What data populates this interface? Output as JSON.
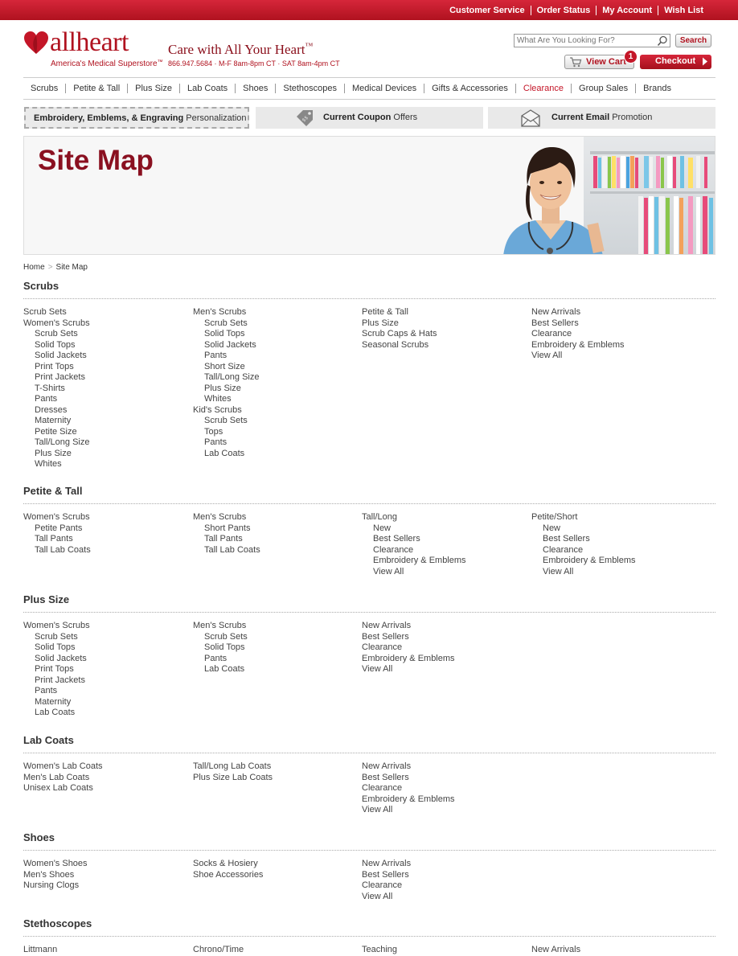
{
  "topbar": {
    "links": [
      "Customer Service",
      "Order Status",
      "My Account",
      "Wish List"
    ]
  },
  "brand": {
    "logo_text": "allheart",
    "tagline": "Care with All Your Heart",
    "superstore": "America's Medical Superstore",
    "hours": "866.947.5684 · M-F 8am-8pm CT · SAT 8am-4pm CT",
    "accent_color": "#b0121f"
  },
  "search": {
    "placeholder": "What Are You Looking For?",
    "button": "Search"
  },
  "cart": {
    "label": "View Cart",
    "count": "1",
    "checkout": "Checkout"
  },
  "nav": [
    "Scrubs",
    "Petite & Tall",
    "Plus Size",
    "Lab Coats",
    "Shoes",
    "Stethoscopes",
    "Medical Devices",
    "Gifts & Accessories",
    "Clearance",
    "Group Sales",
    "Brands"
  ],
  "promos": {
    "personalization_bold": "Embroidery, Emblems, & Engraving",
    "personalization_rest": "Personalization",
    "coupon_bold": "Current Coupon",
    "coupon_rest": "Offers",
    "email_bold": "Current Email",
    "email_rest": "Promotion"
  },
  "page_title": "Site Map",
  "breadcrumb": {
    "home": "Home",
    "current": "Site Map"
  },
  "sections": [
    {
      "title": "Scrubs",
      "columns": [
        [
          {
            "t": "Scrub Sets",
            "sub": false
          },
          {
            "t": "Women's Scrubs",
            "sub": false
          },
          {
            "t": "Scrub Sets",
            "sub": true
          },
          {
            "t": "Solid Tops",
            "sub": true
          },
          {
            "t": "Solid Jackets",
            "sub": true
          },
          {
            "t": "Print Tops",
            "sub": true
          },
          {
            "t": "Print Jackets",
            "sub": true
          },
          {
            "t": "T-Shirts",
            "sub": true
          },
          {
            "t": "Pants",
            "sub": true
          },
          {
            "t": "Dresses",
            "sub": true
          },
          {
            "t": "Maternity",
            "sub": true
          },
          {
            "t": "Petite Size",
            "sub": true
          },
          {
            "t": "Tall/Long Size",
            "sub": true
          },
          {
            "t": "Plus Size",
            "sub": true
          },
          {
            "t": "Whites",
            "sub": true
          }
        ],
        [
          {
            "t": "Men's Scrubs",
            "sub": false
          },
          {
            "t": "Scrub Sets",
            "sub": true
          },
          {
            "t": "Solid Tops",
            "sub": true
          },
          {
            "t": "Solid Jackets",
            "sub": true
          },
          {
            "t": "Pants",
            "sub": true
          },
          {
            "t": "Short Size",
            "sub": true
          },
          {
            "t": "Tall/Long Size",
            "sub": true
          },
          {
            "t": "Plus Size",
            "sub": true
          },
          {
            "t": "Whites",
            "sub": true
          },
          {
            "t": "Kid's Scrubs",
            "sub": false
          },
          {
            "t": "Scrub Sets",
            "sub": true
          },
          {
            "t": "Tops",
            "sub": true
          },
          {
            "t": "Pants",
            "sub": true
          },
          {
            "t": "Lab Coats",
            "sub": true
          }
        ],
        [
          {
            "t": "Petite & Tall",
            "sub": false
          },
          {
            "t": "Plus Size",
            "sub": false
          },
          {
            "t": "Scrub Caps & Hats",
            "sub": false
          },
          {
            "t": "Seasonal Scrubs",
            "sub": false
          }
        ],
        [
          {
            "t": "New Arrivals",
            "sub": false
          },
          {
            "t": "Best Sellers",
            "sub": false
          },
          {
            "t": "Clearance",
            "sub": false
          },
          {
            "t": "Embroidery & Emblems",
            "sub": false
          },
          {
            "t": "View All",
            "sub": false
          }
        ]
      ]
    },
    {
      "title": "Petite & Tall",
      "columns": [
        [
          {
            "t": "Women's Scrubs",
            "sub": false
          },
          {
            "t": "Petite Pants",
            "sub": true
          },
          {
            "t": "Tall Pants",
            "sub": true
          },
          {
            "t": "Tall Lab Coats",
            "sub": true
          }
        ],
        [
          {
            "t": "Men's Scrubs",
            "sub": false
          },
          {
            "t": "Short Pants",
            "sub": true
          },
          {
            "t": "Tall Pants",
            "sub": true
          },
          {
            "t": "Tall Lab Coats",
            "sub": true
          }
        ],
        [
          {
            "t": "Tall/Long",
            "sub": false
          },
          {
            "t": "New",
            "sub": true
          },
          {
            "t": "Best Sellers",
            "sub": true
          },
          {
            "t": "Clearance",
            "sub": true
          },
          {
            "t": "Embroidery & Emblems",
            "sub": true
          },
          {
            "t": "View All",
            "sub": true
          }
        ],
        [
          {
            "t": "Petite/Short",
            "sub": false
          },
          {
            "t": "New",
            "sub": true
          },
          {
            "t": "Best Sellers",
            "sub": true
          },
          {
            "t": "Clearance",
            "sub": true
          },
          {
            "t": "Embroidery & Emblems",
            "sub": true
          },
          {
            "t": "View All",
            "sub": true
          }
        ]
      ]
    },
    {
      "title": "Plus Size",
      "columns": [
        [
          {
            "t": "Women's Scrubs",
            "sub": false
          },
          {
            "t": "Scrub Sets",
            "sub": true
          },
          {
            "t": "Solid Tops",
            "sub": true
          },
          {
            "t": "Solid Jackets",
            "sub": true
          },
          {
            "t": "Print Tops",
            "sub": true
          },
          {
            "t": "Print Jackets",
            "sub": true
          },
          {
            "t": "Pants",
            "sub": true
          },
          {
            "t": "Maternity",
            "sub": true
          },
          {
            "t": "Lab Coats",
            "sub": true
          }
        ],
        [
          {
            "t": "Men's Scrubs",
            "sub": false
          },
          {
            "t": "Scrub Sets",
            "sub": true
          },
          {
            "t": "Solid Tops",
            "sub": true
          },
          {
            "t": "Pants",
            "sub": true
          },
          {
            "t": "Lab Coats",
            "sub": true
          }
        ],
        [
          {
            "t": "New Arrivals",
            "sub": false
          },
          {
            "t": "Best Sellers",
            "sub": false
          },
          {
            "t": "Clearance",
            "sub": false
          },
          {
            "t": "Embroidery & Emblems",
            "sub": false
          },
          {
            "t": "View All",
            "sub": false
          }
        ],
        []
      ]
    },
    {
      "title": "Lab Coats",
      "columns": [
        [
          {
            "t": "Women's Lab Coats",
            "sub": false
          },
          {
            "t": "Men's Lab Coats",
            "sub": false
          },
          {
            "t": "Unisex Lab Coats",
            "sub": false
          }
        ],
        [
          {
            "t": "Tall/Long Lab Coats",
            "sub": false
          },
          {
            "t": "Plus Size Lab Coats",
            "sub": false
          }
        ],
        [
          {
            "t": "New Arrivals",
            "sub": false
          },
          {
            "t": "Best Sellers",
            "sub": false
          },
          {
            "t": "Clearance",
            "sub": false
          },
          {
            "t": "Embroidery & Emblems",
            "sub": false
          },
          {
            "t": "View All",
            "sub": false
          }
        ],
        []
      ]
    },
    {
      "title": "Shoes",
      "columns": [
        [
          {
            "t": "Women's Shoes",
            "sub": false
          },
          {
            "t": "Men's Shoes",
            "sub": false
          },
          {
            "t": "Nursing Clogs",
            "sub": false
          }
        ],
        [
          {
            "t": "Socks & Hosiery",
            "sub": false
          },
          {
            "t": "Shoe Accessories",
            "sub": false
          }
        ],
        [
          {
            "t": "New Arrivals",
            "sub": false
          },
          {
            "t": "Best Sellers",
            "sub": false
          },
          {
            "t": "Clearance",
            "sub": false
          },
          {
            "t": "View All",
            "sub": false
          }
        ],
        []
      ]
    },
    {
      "title": "Stethoscopes",
      "columns": [
        [
          {
            "t": "Littmann",
            "sub": false
          }
        ],
        [
          {
            "t": "Chrono/Time",
            "sub": false
          }
        ],
        [
          {
            "t": "Teaching",
            "sub": false
          }
        ],
        [
          {
            "t": "New Arrivals",
            "sub": false
          }
        ]
      ]
    }
  ]
}
